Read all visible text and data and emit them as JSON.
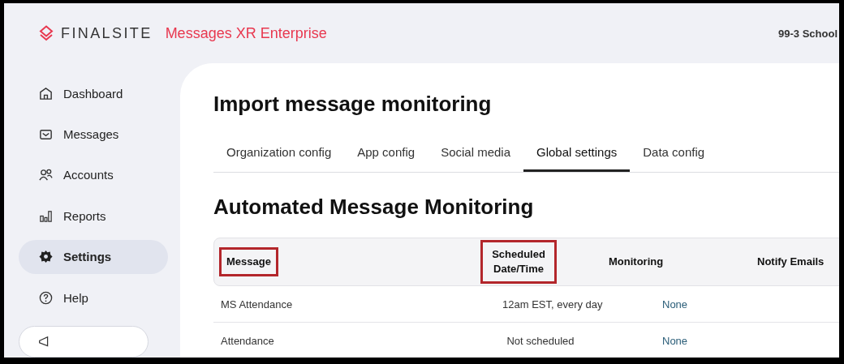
{
  "header": {
    "brand": "FINALSITE",
    "product": "Messages XR Enterprise",
    "organization": "99-3 School"
  },
  "sidebar": {
    "items": [
      {
        "label": "Dashboard",
        "kind": "home",
        "selected": false
      },
      {
        "label": "Messages",
        "kind": "mail",
        "selected": false
      },
      {
        "label": "Accounts",
        "kind": "people",
        "selected": false
      },
      {
        "label": "Reports",
        "kind": "bars",
        "selected": false
      },
      {
        "label": "Settings",
        "kind": "gear",
        "selected": true
      },
      {
        "label": "Help",
        "kind": "help",
        "selected": false
      }
    ]
  },
  "page": {
    "title": "Import message monitoring",
    "tabs": [
      {
        "label": "Organization config",
        "selected": false
      },
      {
        "label": "App config",
        "selected": false
      },
      {
        "label": "Social media",
        "selected": false
      },
      {
        "label": "Global settings",
        "selected": true
      },
      {
        "label": "Data config",
        "selected": false
      }
    ],
    "section_title": "Automated Message Monitoring",
    "table": {
      "columns": [
        {
          "label": "Message",
          "highlighted": true
        },
        {
          "label": "Scheduled Date/Time",
          "highlighted": true
        },
        {
          "label": "Monitoring",
          "highlighted": false
        },
        {
          "label": "Notify Emails",
          "highlighted": false
        }
      ],
      "rows": [
        {
          "message": "MS Attendance",
          "schedule": "12am EST, every day",
          "monitoring": "None"
        },
        {
          "message": "Attendance",
          "schedule": "Not scheduled",
          "monitoring": "None"
        }
      ]
    }
  }
}
